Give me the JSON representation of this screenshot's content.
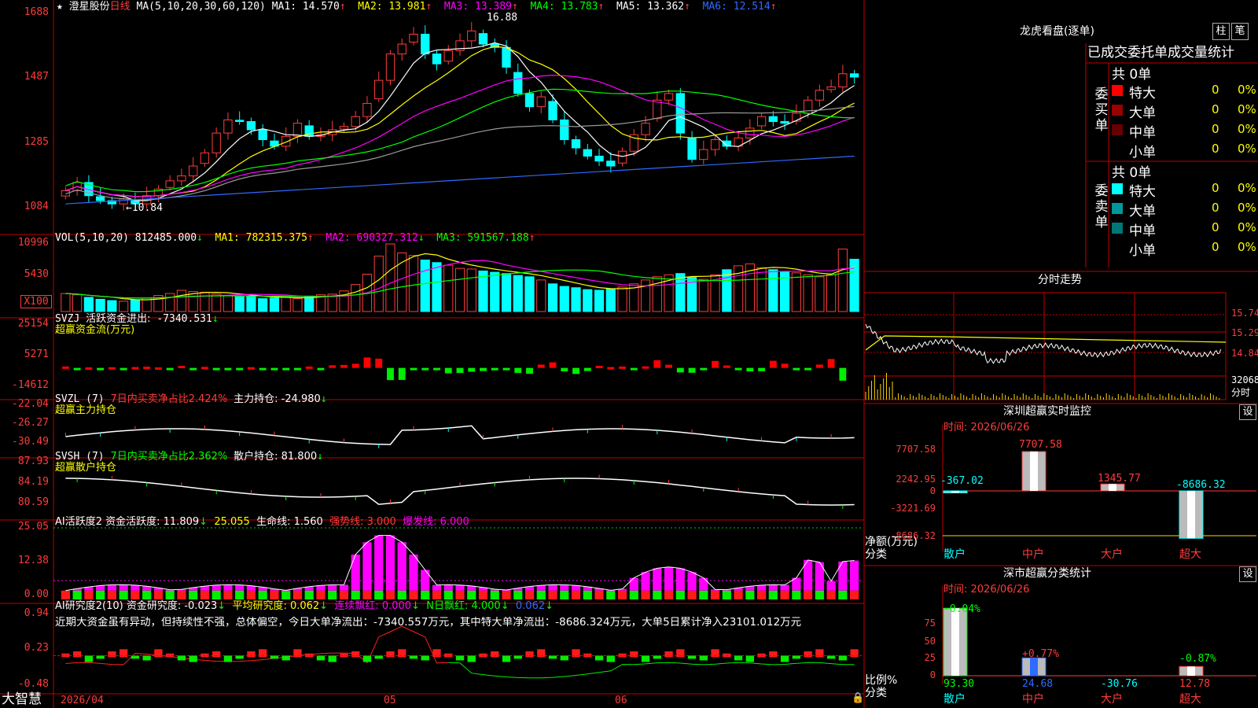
{
  "main": {
    "star": "★",
    "stock_name": "澄星股份",
    "period": "日线",
    "ma_params": "MA(5,10,20,30,60,120)",
    "ma1": "MA1: 14.570",
    "ma2": "MA2: 13.981",
    "ma3": "MA3: 13.389",
    "ma4": "MA4: 13.783",
    "ma5": "MA5: 13.362",
    "ma6": "MA6: 12.514",
    "high_marker": "16.88",
    "low_marker": "←10.84",
    "yticks": [
      "1688",
      "1487",
      "1285",
      "1084"
    ]
  },
  "vol": {
    "label": "VOL(5,10,20)",
    "value": "812485.000",
    "ma1": "MA1: 782315.375",
    "ma2": "MA2: 690327.312",
    "ma3": "MA3: 591567.188",
    "yticks": [
      "10996",
      "5430"
    ],
    "unit": "X100"
  },
  "svzj": {
    "label": "SVZJ",
    "name": "活跃资金进出:",
    "value": "-7340.531",
    "sub": "超赢资金流(万元)",
    "yticks": [
      "25154",
      "5271",
      "-14612"
    ]
  },
  "svzl": {
    "label": "SVZL (7)",
    "ratio": "7日内买卖净占比2.424%",
    "hold": "主力持仓: -24.980",
    "sub": "超赢主力持仓",
    "yticks": [
      "-22.04",
      "-26.27",
      "-30.49"
    ]
  },
  "svsh": {
    "label": "SVSH (7)",
    "ratio": "7日内买卖净占比2.362%",
    "hold": "散户持仓: 81.800",
    "sub": "超赢散户持仓",
    "yticks": [
      "87.93",
      "84.19",
      "80.59"
    ]
  },
  "ai1": {
    "label": "AI活跃度2 资金活跃度:",
    "v1": "11.809",
    "v2": "25.055",
    "v3": "生命线: 1.560",
    "v4": "强势线: 3.000",
    "v5": "爆发线: 6.000",
    "yticks": [
      "25.05",
      "12.38",
      "0.00"
    ]
  },
  "ai2": {
    "label": "AI研究度2(10) 资金研究度:",
    "v1": "-0.023",
    "v2": "平均研究度: 0.062",
    "v3": "连续飘红: 0.000",
    "v4": "N日飘红: 4.000",
    "v5": "0.062",
    "summary": "近期大资金虽有异动，但持续性不强，总体偏空，今日大单净流出：-7340.557万元，其中特大单净流出：-8686.324万元，大单5日累计净入23101.012万元",
    "yticks": [
      "0.94",
      "0.23",
      "-0.48"
    ]
  },
  "bottom": {
    "brand": "大智慧",
    "dates": [
      "2026/04",
      "05",
      "06"
    ]
  },
  "right": {
    "lhb_title": "龙虎看盘(逐单)",
    "btn_col": "柱",
    "btn_count": "笔",
    "order_header": "已成交委托单成交量统计",
    "buy_label": "委买单",
    "sell_label": "委卖单",
    "buy_total": "共 0单",
    "sell_total": "共 0单",
    "buy_rows": [
      {
        "label": "特大",
        "count": "0",
        "pct": "0%",
        "color": "#ff0000"
      },
      {
        "label": "大单",
        "count": "0",
        "pct": "0%",
        "color": "#990000"
      },
      {
        "label": "中单",
        "count": "0",
        "pct": "0%",
        "color": "#660000"
      },
      {
        "label": "小单",
        "count": "0",
        "pct": "0%",
        "color": "#000000"
      }
    ],
    "sell_rows": [
      {
        "label": "特大",
        "count": "0",
        "pct": "0%",
        "color": "#00ffff"
      },
      {
        "label": "大单",
        "count": "0",
        "pct": "0%",
        "color": "#009999"
      },
      {
        "label": "中单",
        "count": "0",
        "pct": "0%",
        "color": "#007777"
      },
      {
        "label": "小单",
        "count": "0",
        "pct": "0%",
        "color": "#000000"
      }
    ],
    "intraday_title": "分时走势",
    "intraday_ticks": [
      "15.74",
      "15.29",
      "14.84"
    ],
    "intraday_vol": "32068",
    "intraday_unit": "分时",
    "sz_title": "深圳超赢实时监控",
    "set_label": "设",
    "sz_time": "时间: 2026/06/26",
    "sz_yticks": [
      "7707.58",
      "2242.95",
      "0",
      "-3221.69",
      "-8686.32"
    ],
    "net_label": "净额(万元)",
    "cat_label": "分类",
    "sz_values": [
      "-367.02",
      "7707.58",
      "1345.77",
      "-8686.32"
    ],
    "categories": [
      "散户",
      "中户",
      "大户",
      "超大"
    ],
    "cls_title": "深市超赢分类统计",
    "cls_time": "时间: 2026/06/26",
    "cls_yticks": [
      "75",
      "50",
      "25",
      "0",
      "0"
    ],
    "ratio_label": "比例%",
    "cls_changes": [
      "-0.04%",
      "+0.77%",
      "",
      "-0.87%"
    ],
    "cls_values": [
      "93.30",
      "24.68",
      "-30.76",
      "12.78"
    ]
  },
  "colors": {
    "up": "#ff3c3c",
    "down": "#00ffff",
    "frame": "#c00000",
    "ma1": "#ffffff",
    "ma2": "#ffff00",
    "ma3": "#ff00ff",
    "ma4": "#00ff00",
    "ma5": "#999999",
    "ma6": "#2f6bff"
  },
  "chart_data": [
    {
      "type": "candlestick",
      "title": "澄星股份 日线",
      "ylim": [
        10.84,
        16.88
      ],
      "dates_shown": [
        "2026/04",
        "05",
        "06"
      ],
      "ohlc_close": [
        11.45,
        11.7,
        11.3,
        11.15,
        11.05,
        11.2,
        11.05,
        11.3,
        11.5,
        11.75,
        11.9,
        12.2,
        12.6,
        13.2,
        13.6,
        13.55,
        13.3,
        13.0,
        12.8,
        13.1,
        13.5,
        13.1,
        13.15,
        13.3,
        13.4,
        13.7,
        14.1,
        14.8,
        15.6,
        15.9,
        16.2,
        15.6,
        15.3,
        15.7,
        16.0,
        16.3,
        15.9,
        15.8,
        15.2,
        14.4,
        14.0,
        14.3,
        13.6,
        13.0,
        12.75,
        12.5,
        12.35,
        12.2,
        12.65,
        13.15,
        13.5,
        14.2,
        14.4,
        13.2,
        12.4,
        12.7,
        13.0,
        12.8,
        13.05,
        13.35,
        13.7,
        13.55,
        13.5,
        13.8,
        14.2,
        14.5,
        14.6,
        15.0,
        14.9
      ],
      "ma_latest": {
        "MA5": 14.57,
        "MA10": 13.981,
        "MA20": 13.389,
        "MA30": 13.783,
        "MA60": 13.362,
        "MA120": 12.514
      },
      "high": 16.88,
      "low": 10.84
    },
    {
      "type": "bar",
      "title": "VOL(5,10,20)",
      "unit": "X100",
      "ylim": [
        0,
        10996
      ],
      "values": [
        2800,
        2600,
        2200,
        1900,
        1700,
        1600,
        1800,
        2100,
        2500,
        2800,
        3300,
        3100,
        3000,
        2700,
        2500,
        2300,
        2400,
        2000,
        2100,
        2200,
        2000,
        2400,
        2600,
        2700,
        3200,
        4200,
        5800,
        8600,
        10500,
        9100,
        8700,
        8000,
        7600,
        7200,
        6700,
        6600,
        6300,
        6100,
        5900,
        5600,
        5400,
        4900,
        4300,
        3900,
        3700,
        3400,
        3300,
        3500,
        3800,
        4300,
        4900,
        5400,
        5700,
        5900,
        5300,
        5000,
        5700,
        6500,
        7100,
        7400,
        6800,
        6500,
        6200,
        6000,
        5700,
        5400,
        5700,
        9700,
        8125
      ]
    },
    {
      "type": "bar",
      "title": "超赢资金流(万元)",
      "ylim": [
        -14612,
        25154
      ],
      "values": [
        800,
        -400,
        300,
        -600,
        400,
        -300,
        500,
        700,
        300,
        -700,
        1200,
        -600,
        600,
        -900,
        -800,
        -600,
        400,
        -1300,
        -700,
        -500,
        -1100,
        800,
        -500,
        1500,
        1700,
        2400,
        6000,
        5300,
        -7000,
        -6900,
        -300,
        -900,
        -1000,
        -3100,
        -2900,
        -2200,
        -1800,
        -1400,
        -1000,
        -2900,
        -3400,
        1900,
        3200,
        -2000,
        -3500,
        -1800,
        1200,
        500,
        800,
        -600,
        900,
        4400,
        1800,
        -2600,
        -2800,
        -1000,
        4000,
        1400,
        -700,
        -2000,
        -1900,
        4100,
        2400,
        -800,
        -1100,
        1900,
        5100,
        -7340
      ]
    }
  ]
}
